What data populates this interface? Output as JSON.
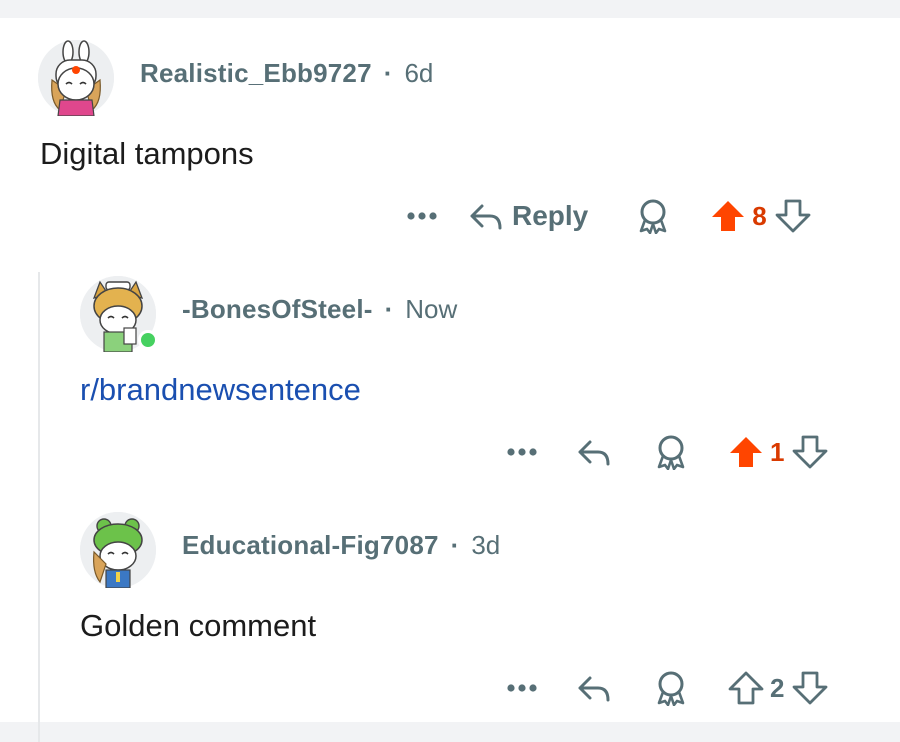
{
  "comments": [
    {
      "username": "Realistic_Ebb9727",
      "time": "6d",
      "body": "Digital tampons",
      "reply_label": "Reply",
      "score": "8",
      "upvoted": true
    },
    {
      "username": "-BonesOfSteel-",
      "time": "Now",
      "body": "r/brandnewsentence",
      "score": "1",
      "upvoted": true,
      "online": true
    },
    {
      "username": "Educational-Fig7087",
      "time": "3d",
      "body": "Golden comment",
      "score": "2",
      "upvoted": false
    }
  ],
  "separator": "·",
  "colors": {
    "upvote": "#ff4500",
    "score_upvoted": "#d93a00",
    "muted": "#576f76",
    "link": "#1a4fb0",
    "online": "#46d160"
  },
  "icons": [
    "more-icon",
    "reply-icon",
    "award-icon",
    "upvote-icon",
    "downvote-icon"
  ]
}
